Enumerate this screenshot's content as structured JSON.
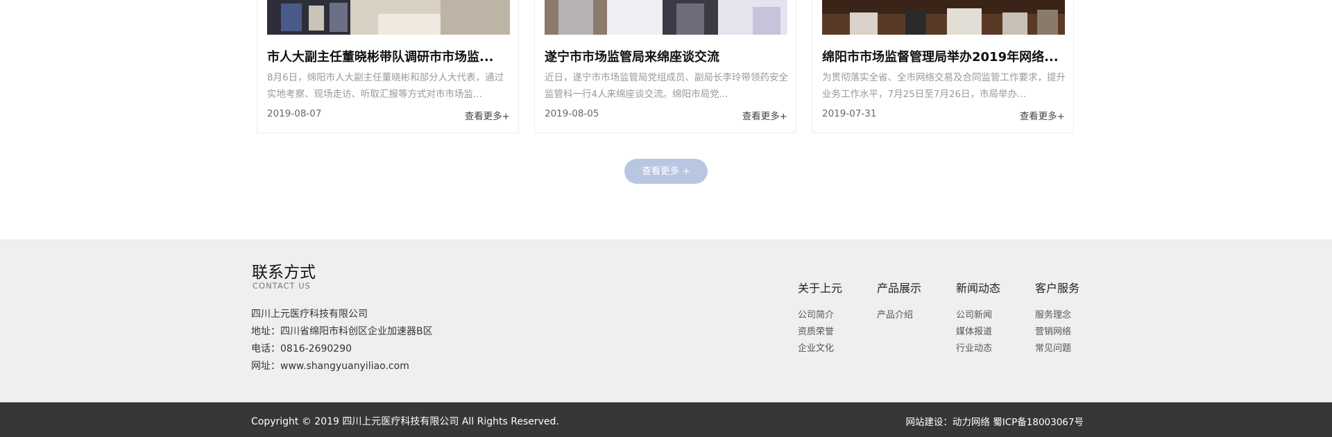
{
  "news": {
    "cards": [
      {
        "title": "市人大副主任董晓彬带队调研市市场监...",
        "desc": "8月6日，绵阳市人大副主任董晓彬和部分人大代表，通过实地考察、现场走访、听取汇报等方式对市市场监...",
        "date": "2019-08-07",
        "more": "查看更多+"
      },
      {
        "title": "遂宁市市场监管局来绵座谈交流",
        "desc": "近日，遂宁市市场监管局党组成员、副局长李玲带领药安全监管科一行4人来绵座谈交流。绵阳市局党...",
        "date": "2019-08-05",
        "more": "查看更多+"
      },
      {
        "title": "绵阳市市场监督管理局举办2019年网络...",
        "desc": "为贯彻落实全省、全市网络交易及合同监管工作要求，提升业务工作水平，7月25日至7月26日，市局举办...",
        "date": "2019-07-31",
        "more": "查看更多+"
      }
    ],
    "more_button": "查看更多 +"
  },
  "footer": {
    "contact_title": "联系方式",
    "contact_sub": "CONTACT US",
    "company": "四川上元医疗科技有限公司",
    "address": "地址：四川省绵阳市科创区企业加速器B区",
    "phone": "电话：0816-2690290",
    "website": "网址：www.shangyuanyiliao.com",
    "columns": [
      {
        "title": "关于上元",
        "items": [
          "公司简介",
          "资质荣誉",
          "企业文化"
        ]
      },
      {
        "title": "产品展示",
        "items": [
          "产品介绍"
        ]
      },
      {
        "title": "新闻动态",
        "items": [
          "公司新闻",
          "媒体报道",
          "行业动态"
        ]
      },
      {
        "title": "客户服务",
        "items": [
          "服务理念",
          "营销网络",
          "常见问题"
        ]
      }
    ]
  },
  "bottom": {
    "copyright": "Copyright © 2019 四川上元医疗科技有限公司 All Rights Reserved.",
    "build": "网站建设：动力网络  蜀ICP备18003067号"
  }
}
